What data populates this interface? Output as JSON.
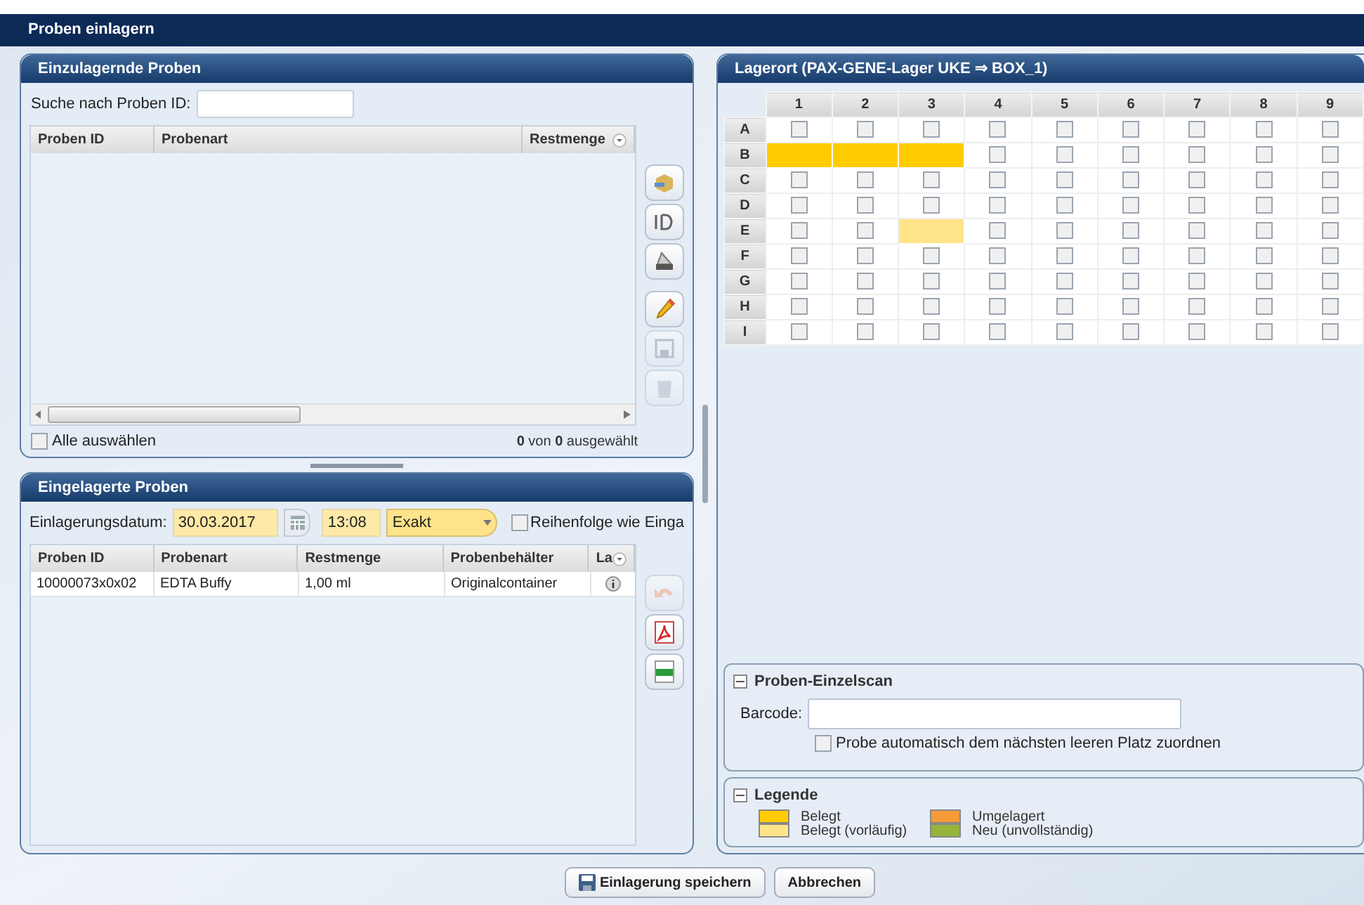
{
  "window": {
    "title": "Proben einlagern"
  },
  "pending": {
    "title": "Einzulagernde Proben",
    "search_label": "Suche nach Proben ID:",
    "columns": [
      "Proben ID",
      "Probenart",
      "Restmenge"
    ],
    "tools": [
      {
        "kind": "box",
        "disabled": false
      },
      {
        "kind": "id",
        "disabled": false
      },
      {
        "kind": "scanner",
        "disabled": false
      },
      {
        "kind": "pencil",
        "disabled": false
      },
      {
        "kind": "save",
        "disabled": true
      },
      {
        "kind": "trash",
        "disabled": true
      }
    ],
    "select_all": {
      "label": "Alle auswählen",
      "checked": false
    },
    "count": "**0** von **0** ausgewählt"
  },
  "stored": {
    "title": "Eingelagerte Proben",
    "date_label": "Einlagerungsdatum:",
    "date": "30.03.2017",
    "time": "13:08",
    "mode": "Exakt",
    "order": {
      "label": "Reihenfolge wie Einga",
      "checked": false
    },
    "columns": [
      "Proben ID",
      "Probenart",
      "Restmenge",
      "Probenbehälter",
      "La"
    ],
    "rows": [
      {
        "id": "10000073x0x02",
        "type": "EDTA Buffy",
        "amount": "1,00 ml",
        "container": "Originalcontainer"
      }
    ],
    "tools": [
      {
        "kind": "undo",
        "disabled": true
      },
      {
        "kind": "pdf",
        "disabled": false
      },
      {
        "kind": "csv",
        "disabled": false
      }
    ]
  },
  "location": {
    "title": "Lagerort (PAX-GENE-Lager UKE ⇒ BOX_1)",
    "columns": [
      "1",
      "2",
      "3",
      "4",
      "5",
      "6",
      "7",
      "8",
      "9"
    ],
    "rows": [
      {
        "label": "A",
        "cells": [
          {
            "kind": "checkbox"
          },
          {
            "kind": "checkbox"
          },
          {
            "kind": "checkbox"
          },
          {
            "kind": "checkbox"
          },
          {
            "kind": "checkbox"
          },
          {
            "kind": "checkbox"
          },
          {
            "kind": "checkbox"
          },
          {
            "kind": "checkbox"
          },
          {
            "kind": "checkbox"
          }
        ]
      },
      {
        "label": "B",
        "cells": [
          {
            "kind": "occupied"
          },
          {
            "kind": "occupied"
          },
          {
            "kind": "occupied"
          },
          {
            "kind": "checkbox"
          },
          {
            "kind": "checkbox"
          },
          {
            "kind": "checkbox"
          },
          {
            "kind": "checkbox"
          },
          {
            "kind": "checkbox"
          },
          {
            "kind": "checkbox"
          }
        ]
      },
      {
        "label": "C",
        "cells": [
          {
            "kind": "checkbox"
          },
          {
            "kind": "checkbox"
          },
          {
            "kind": "checkbox"
          },
          {
            "kind": "checkbox"
          },
          {
            "kind": "checkbox"
          },
          {
            "kind": "checkbox"
          },
          {
            "kind": "checkbox"
          },
          {
            "kind": "checkbox"
          },
          {
            "kind": "checkbox"
          }
        ]
      },
      {
        "label": "D",
        "cells": [
          {
            "kind": "checkbox"
          },
          {
            "kind": "checkbox"
          },
          {
            "kind": "checkbox"
          },
          {
            "kind": "checkbox"
          },
          {
            "kind": "checkbox"
          },
          {
            "kind": "checkbox"
          },
          {
            "kind": "checkbox"
          },
          {
            "kind": "checkbox"
          },
          {
            "kind": "checkbox"
          }
        ]
      },
      {
        "label": "E",
        "cells": [
          {
            "kind": "checkbox"
          },
          {
            "kind": "checkbox"
          },
          {
            "kind": "provisional"
          },
          {
            "kind": "checkbox"
          },
          {
            "kind": "checkbox"
          },
          {
            "kind": "checkbox"
          },
          {
            "kind": "checkbox"
          },
          {
            "kind": "checkbox"
          },
          {
            "kind": "checkbox"
          }
        ]
      },
      {
        "label": "F",
        "cells": [
          {
            "kind": "checkbox"
          },
          {
            "kind": "checkbox"
          },
          {
            "kind": "checkbox"
          },
          {
            "kind": "checkbox"
          },
          {
            "kind": "checkbox"
          },
          {
            "kind": "checkbox"
          },
          {
            "kind": "checkbox"
          },
          {
            "kind": "checkbox"
          },
          {
            "kind": "checkbox"
          }
        ]
      },
      {
        "label": "G",
        "cells": [
          {
            "kind": "checkbox"
          },
          {
            "kind": "checkbox"
          },
          {
            "kind": "checkbox"
          },
          {
            "kind": "checkbox"
          },
          {
            "kind": "checkbox"
          },
          {
            "kind": "checkbox"
          },
          {
            "kind": "checkbox"
          },
          {
            "kind": "checkbox"
          },
          {
            "kind": "checkbox"
          }
        ]
      },
      {
        "label": "H",
        "cells": [
          {
            "kind": "checkbox"
          },
          {
            "kind": "checkbox"
          },
          {
            "kind": "checkbox"
          },
          {
            "kind": "checkbox"
          },
          {
            "kind": "checkbox"
          },
          {
            "kind": "checkbox"
          },
          {
            "kind": "checkbox"
          },
          {
            "kind": "checkbox"
          },
          {
            "kind": "checkbox"
          }
        ]
      },
      {
        "label": "I",
        "cells": [
          {
            "kind": "checkbox"
          },
          {
            "kind": "checkbox"
          },
          {
            "kind": "checkbox"
          },
          {
            "kind": "checkbox"
          },
          {
            "kind": "checkbox"
          },
          {
            "kind": "checkbox"
          },
          {
            "kind": "checkbox"
          },
          {
            "kind": "checkbox"
          },
          {
            "kind": "checkbox"
          }
        ]
      }
    ]
  },
  "scan": {
    "title": "Proben-Einzelscan",
    "expanded": true,
    "barcode_label": "Barcode:",
    "auto": {
      "label": "Probe automatisch dem nächsten leeren Platz zuordnen",
      "checked": false
    }
  },
  "legend": {
    "title": "Legende",
    "expanded": true,
    "items": [
      {
        "label": "Belegt",
        "color": "#ffcc00"
      },
      {
        "label": "Belegt (vorläufig)",
        "color": "#ffe48a"
      },
      {
        "label": "Umgelagert",
        "color": "#f79a3a"
      },
      {
        "label": "Neu (unvollständig)",
        "color": "#94b43c"
      }
    ]
  },
  "buttons": [
    {
      "label": "Einlagerung speichern",
      "icon": true
    },
    {
      "label": "Abbrechen",
      "icon": false
    }
  ]
}
